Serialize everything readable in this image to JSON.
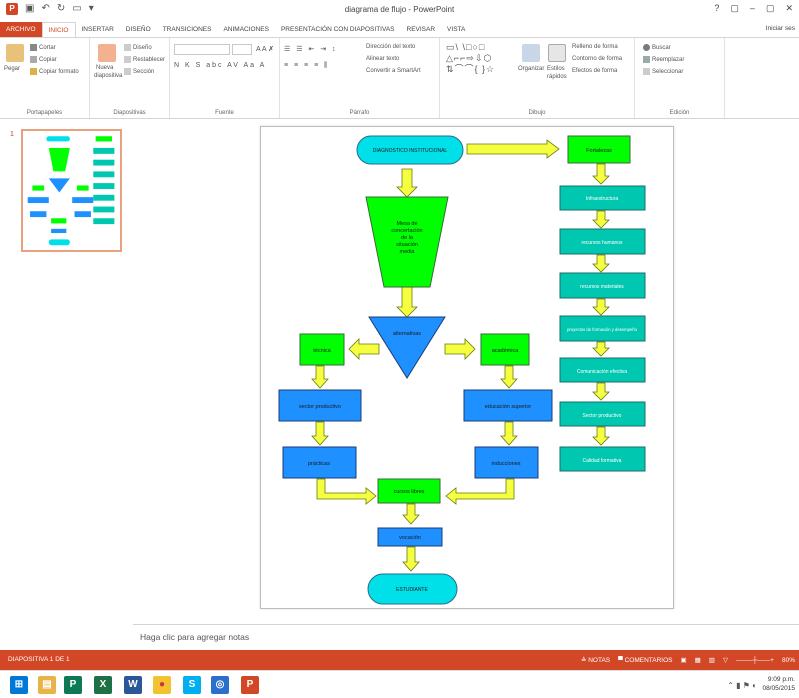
{
  "window": {
    "title": "diagrama de flujo - PowerPoint",
    "controls": [
      "?",
      "▢",
      "–",
      "▢",
      "✕"
    ],
    "signin": "Iniciar ses"
  },
  "ribbon_tabs": [
    "ARCHIVO",
    "INICIO",
    "INSERTAR",
    "DISEÑO",
    "TRANSICIONES",
    "ANIMACIONES",
    "PRESENTACIÓN CON DIAPOSITIVAS",
    "REVISAR",
    "VISTA"
  ],
  "ribbon": {
    "portapapeles": {
      "label": "Portapapeles",
      "pegar": "Pegar",
      "cortar": "Cortar",
      "copiar": "Copiar",
      "copiar_formato": "Copiar formato"
    },
    "diapositivas": {
      "label": "Diapositivas",
      "nueva": "Nueva",
      "diapositiva": "diapositiva",
      "diseno": "Diseño",
      "restablecer": "Restablecer",
      "seccion": "Sección"
    },
    "fuente": {
      "label": "Fuente"
    },
    "parrafo": {
      "label": "Párrafo",
      "direccion": "Dirección del texto",
      "alinear": "Alinear texto",
      "smartart": "Convertir a SmartArt"
    },
    "dibujo": {
      "label": "Dibujo",
      "organizar": "Organizar",
      "estilos": "Estilos",
      "rapidos": "rápidos",
      "relleno": "Relleno de forma",
      "contorno": "Contorno de forma",
      "efectos": "Efectos de forma"
    },
    "edicion": {
      "label": "Edición",
      "buscar": "Buscar",
      "reemplazar": "Reemplazar",
      "seleccionar": "Seleccionar"
    }
  },
  "thumbnail": {
    "number": "1"
  },
  "flowchart": {
    "diagnostico": "DIAGNOSTICO INSTITUCIONAL",
    "fortalezas": "Fortalezas",
    "mesa": "Mesa de concertación de la situación media",
    "alternativas": "alternativas",
    "tecnica": "técnica",
    "academica": "académica",
    "sector_productivo": "sector productivo",
    "educacion_superior": "educación superior",
    "practicas": "prácticas",
    "inducciones": "inducciones",
    "cursos_libres": "cursos libres",
    "vocacion": "vocación",
    "estudiante": "ESTUDIANTE",
    "right_col": [
      "Infraestructura",
      "recursos humanos",
      "recursos materiales",
      "proyectos de formación y desempeño",
      "Comunicación efectiva",
      "Sector productivo",
      "Calidad formativa"
    ]
  },
  "notes": {
    "placeholder": "Haga clic para agregar notas"
  },
  "status": {
    "slide": "DIAPOSITIVA 1 DE 1",
    "notas": "NOTAS",
    "comentarios": "COMENTARIOS",
    "zoom": "80%"
  },
  "tray": {
    "time": "9:09 p.m.",
    "date": "08/05/2015"
  },
  "colors": {
    "accent": "#d24726",
    "green": "#00ff00",
    "cyan": "#00e0e8",
    "teal": "#00c8b0",
    "blue": "#1e90ff",
    "yellow": "#f5ff40"
  }
}
